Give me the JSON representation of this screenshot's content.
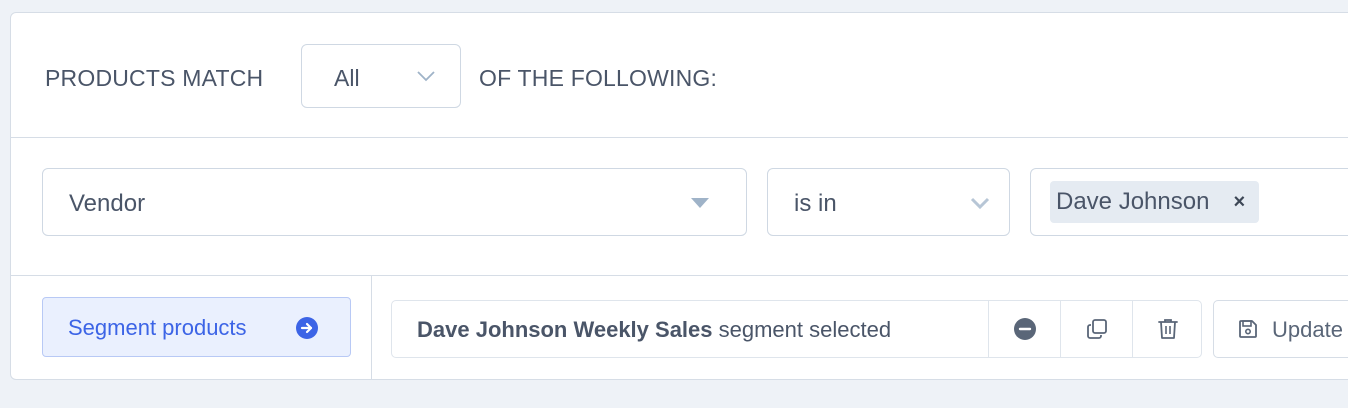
{
  "filter": {
    "match_prefix": "PRODUCTS MATCH",
    "match_value": "All",
    "match_suffix": "OF THE FOLLOWING:"
  },
  "condition": {
    "field": "Vendor",
    "operator": "is in",
    "values": [
      "Dave Johnson"
    ],
    "remove_tag_symbol": "×"
  },
  "actions": {
    "segment_button_label": "Segment products",
    "segment_name": "Dave Johnson Weekly Sales",
    "segment_status": " segment selected",
    "update_label": "Update"
  },
  "icons": {
    "match_chevron": "chevron-down-icon",
    "field_caret": "caret-down-icon",
    "operator_chevron": "chevron-down-icon",
    "remove_tag": "close-icon",
    "segment_arrow": "arrow-right-circle-icon",
    "deselect": "minus-circle-icon",
    "duplicate": "copy-icon",
    "delete": "trash-icon",
    "update": "save-icon"
  },
  "colors": {
    "accent": "#3c64e6",
    "accent_bg": "#eaf0fe",
    "border": "#d6dde6",
    "text": "#4a5568",
    "page_bg": "#eef2f7"
  }
}
